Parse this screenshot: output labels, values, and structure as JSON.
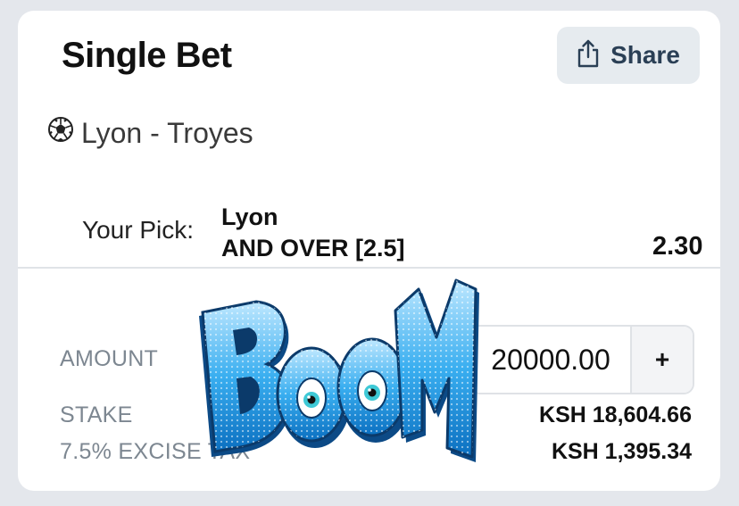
{
  "bet": {
    "title": "Single Bet",
    "share_label": "Share",
    "match": "Lyon - Troyes",
    "pick_label": "Your Pick:",
    "pick_line1": "Lyon",
    "pick_line2": "AND OVER [2.5]",
    "odds": "2.30"
  },
  "summary": {
    "amount_label": "AMOUNT",
    "amount_value": "20000.00",
    "plus_label": "+",
    "stake_label": "STAKE",
    "stake_value": "KSH 18,604.66",
    "excise_label": "7.5% EXCISE TAX",
    "excise_value": "KSH 1,395.34"
  },
  "overlay": {
    "text": "BOOM"
  },
  "icons": {
    "share": "share-icon",
    "sport": "soccer-ball-icon"
  },
  "colors": {
    "background": "#e4e7ec",
    "card": "#ffffff",
    "share_bg": "#e6ebef",
    "share_text": "#2a3f55",
    "boom_blue": "#2aa3e6"
  }
}
